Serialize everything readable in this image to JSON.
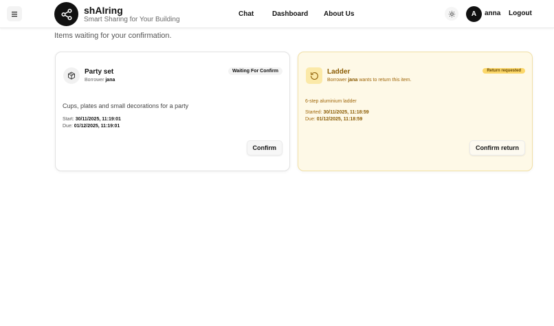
{
  "header": {
    "brand_title": "shAIring",
    "brand_subtitle": "Smart Sharing for Your Building",
    "nav": [
      "Chat",
      "Dashboard",
      "About Us"
    ],
    "user_initial": "A",
    "username": "anna",
    "logout": "Logout"
  },
  "page": {
    "subtitle": "Items waiting for your confirmation."
  },
  "cards": [
    {
      "title": "Party set",
      "borrower_label": "Borrower",
      "borrower_name": "jana",
      "badge": "Waiting For Confirm",
      "description": "Cups, plates and small decorations for a party",
      "date1_label": "Start:",
      "date1_value": "30/11/2025, 11:19:01",
      "date2_label": "Due:",
      "date2_value": "01/12/2025, 11:19:01",
      "action": "Confirm"
    },
    {
      "title": "Ladder",
      "borrower_label": "Borrower",
      "borrower_name": "jana",
      "borrower_suffix": "wants to return this item.",
      "badge": "Return requested",
      "description": "6-step aluminium ladder",
      "date1_label": "Started:",
      "date1_value": "30/11/2025, 11:18:59",
      "date2_label": "Due:",
      "date2_value": "01/12/2025, 11:18:59",
      "action": "Confirm return"
    }
  ],
  "icons": {
    "menu": "menu-icon",
    "logo": "share-icon",
    "theme": "sun-icon",
    "card1": "package-icon",
    "card2": "rotate-ccw-icon"
  },
  "colors": {
    "accent_dark": "#111111",
    "return_bg": "#fef9e7",
    "return_badge": "#fbd76a"
  }
}
